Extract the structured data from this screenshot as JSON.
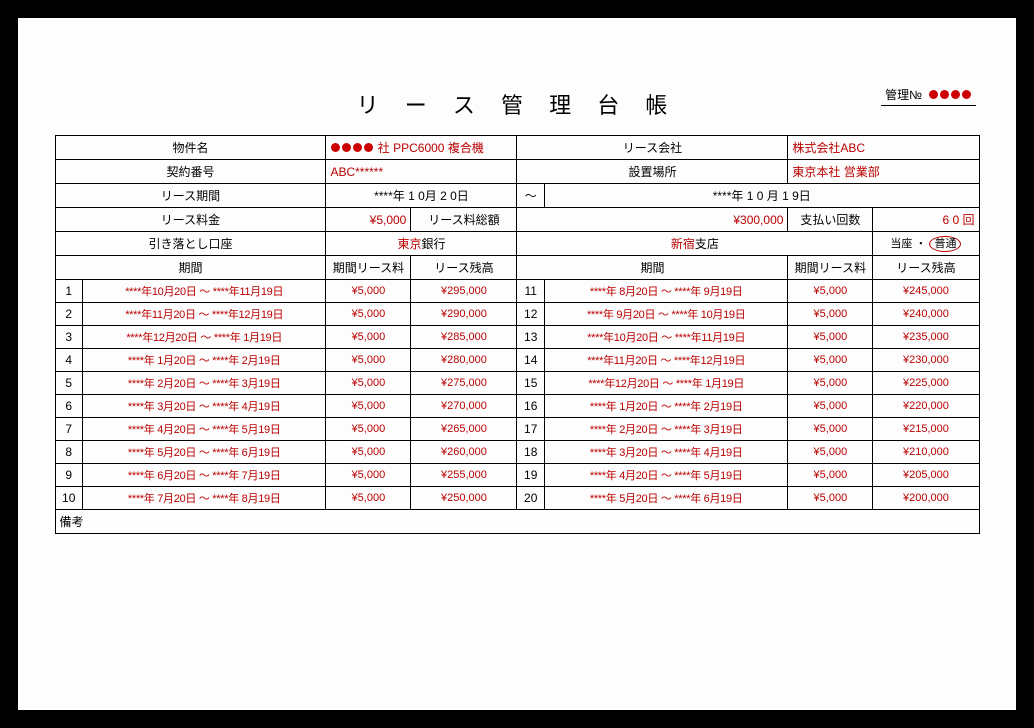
{
  "management_no_label": "管理№",
  "title": "リ ー ス 管 理 台 帳",
  "header": {
    "property_label": "物件名",
    "property_value_prefix_dots": 4,
    "property_value": "社 PPC6000 複合機",
    "lease_company_label": "リース会社",
    "lease_company_value": "株式会社ABC",
    "contract_no_label": "契約番号",
    "contract_no_value": "ABC******",
    "location_label": "設置場所",
    "location_value": "東京本社 営業部",
    "lease_period_label": "リース期間",
    "lease_start": "****年 1 0月 2 0日",
    "lease_tilde": "～",
    "lease_end": "****年 1 0 月 1 9日",
    "lease_fee_label": "リース料金",
    "lease_fee_value": "¥5,000",
    "lease_total_label": "リース料総額",
    "lease_total_value": "¥300,000",
    "pay_count_label": "支払い回数",
    "pay_count_value": "6 0 回",
    "debit_acct_label": "引き落とし口座",
    "bank_red": "東京",
    "bank_black": "銀行",
    "branch_red": "新宿",
    "branch_black": "支店",
    "acct_type_touza": "当座",
    "acct_type_sep": "・",
    "acct_type_futsu": "普通"
  },
  "cols": {
    "period": "期間",
    "period_fee": "期間リース料",
    "balance": "リース残高"
  },
  "rows_left": [
    {
      "n": 1,
      "period": "****年10月20日 ～ ****年11月19日",
      "fee": "¥5,000",
      "bal": "¥295,000"
    },
    {
      "n": 2,
      "period": "****年11月20日 ～ ****年12月19日",
      "fee": "¥5,000",
      "bal": "¥290,000"
    },
    {
      "n": 3,
      "period": "****年12月20日 ～ ****年 1月19日",
      "fee": "¥5,000",
      "bal": "¥285,000"
    },
    {
      "n": 4,
      "period": "****年 1月20日 ～ ****年 2月19日",
      "fee": "¥5,000",
      "bal": "¥280,000"
    },
    {
      "n": 5,
      "period": "****年 2月20日 ～ ****年 3月19日",
      "fee": "¥5,000",
      "bal": "¥275,000"
    },
    {
      "n": 6,
      "period": "****年 3月20日 ～ ****年 4月19日",
      "fee": "¥5,000",
      "bal": "¥270,000"
    },
    {
      "n": 7,
      "period": "****年 4月20日 ～ ****年 5月19日",
      "fee": "¥5,000",
      "bal": "¥265,000"
    },
    {
      "n": 8,
      "period": "****年 5月20日 ～ ****年 6月19日",
      "fee": "¥5,000",
      "bal": "¥260,000"
    },
    {
      "n": 9,
      "period": "****年 6月20日 ～ ****年 7月19日",
      "fee": "¥5,000",
      "bal": "¥255,000"
    },
    {
      "n": 10,
      "period": "****年 7月20日 ～ ****年 8月19日",
      "fee": "¥5,000",
      "bal": "¥250,000"
    }
  ],
  "rows_right": [
    {
      "n": 11,
      "period": "****年 8月20日 ～ ****年 9月19日",
      "fee": "¥5,000",
      "bal": "¥245,000"
    },
    {
      "n": 12,
      "period": "****年 9月20日 ～ ****年 10月19日",
      "fee": "¥5,000",
      "bal": "¥240,000"
    },
    {
      "n": 13,
      "period": "****年10月20日 ～ ****年11月19日",
      "fee": "¥5,000",
      "bal": "¥235,000"
    },
    {
      "n": 14,
      "period": "****年11月20日 ～ ****年12月19日",
      "fee": "¥5,000",
      "bal": "¥230,000"
    },
    {
      "n": 15,
      "period": "****年12月20日 ～ ****年 1月19日",
      "fee": "¥5,000",
      "bal": "¥225,000"
    },
    {
      "n": 16,
      "period": "****年 1月20日 ～ ****年 2月19日",
      "fee": "¥5,000",
      "bal": "¥220,000"
    },
    {
      "n": 17,
      "period": "****年 2月20日 ～ ****年 3月19日",
      "fee": "¥5,000",
      "bal": "¥215,000"
    },
    {
      "n": 18,
      "period": "****年 3月20日 ～ ****年 4月19日",
      "fee": "¥5,000",
      "bal": "¥210,000"
    },
    {
      "n": 19,
      "period": "****年 4月20日 ～ ****年 5月19日",
      "fee": "¥5,000",
      "bal": "¥205,000"
    },
    {
      "n": 20,
      "period": "****年 5月20日 ～ ****年 6月19日",
      "fee": "¥5,000",
      "bal": "¥200,000"
    }
  ],
  "remarks_label": "備考"
}
